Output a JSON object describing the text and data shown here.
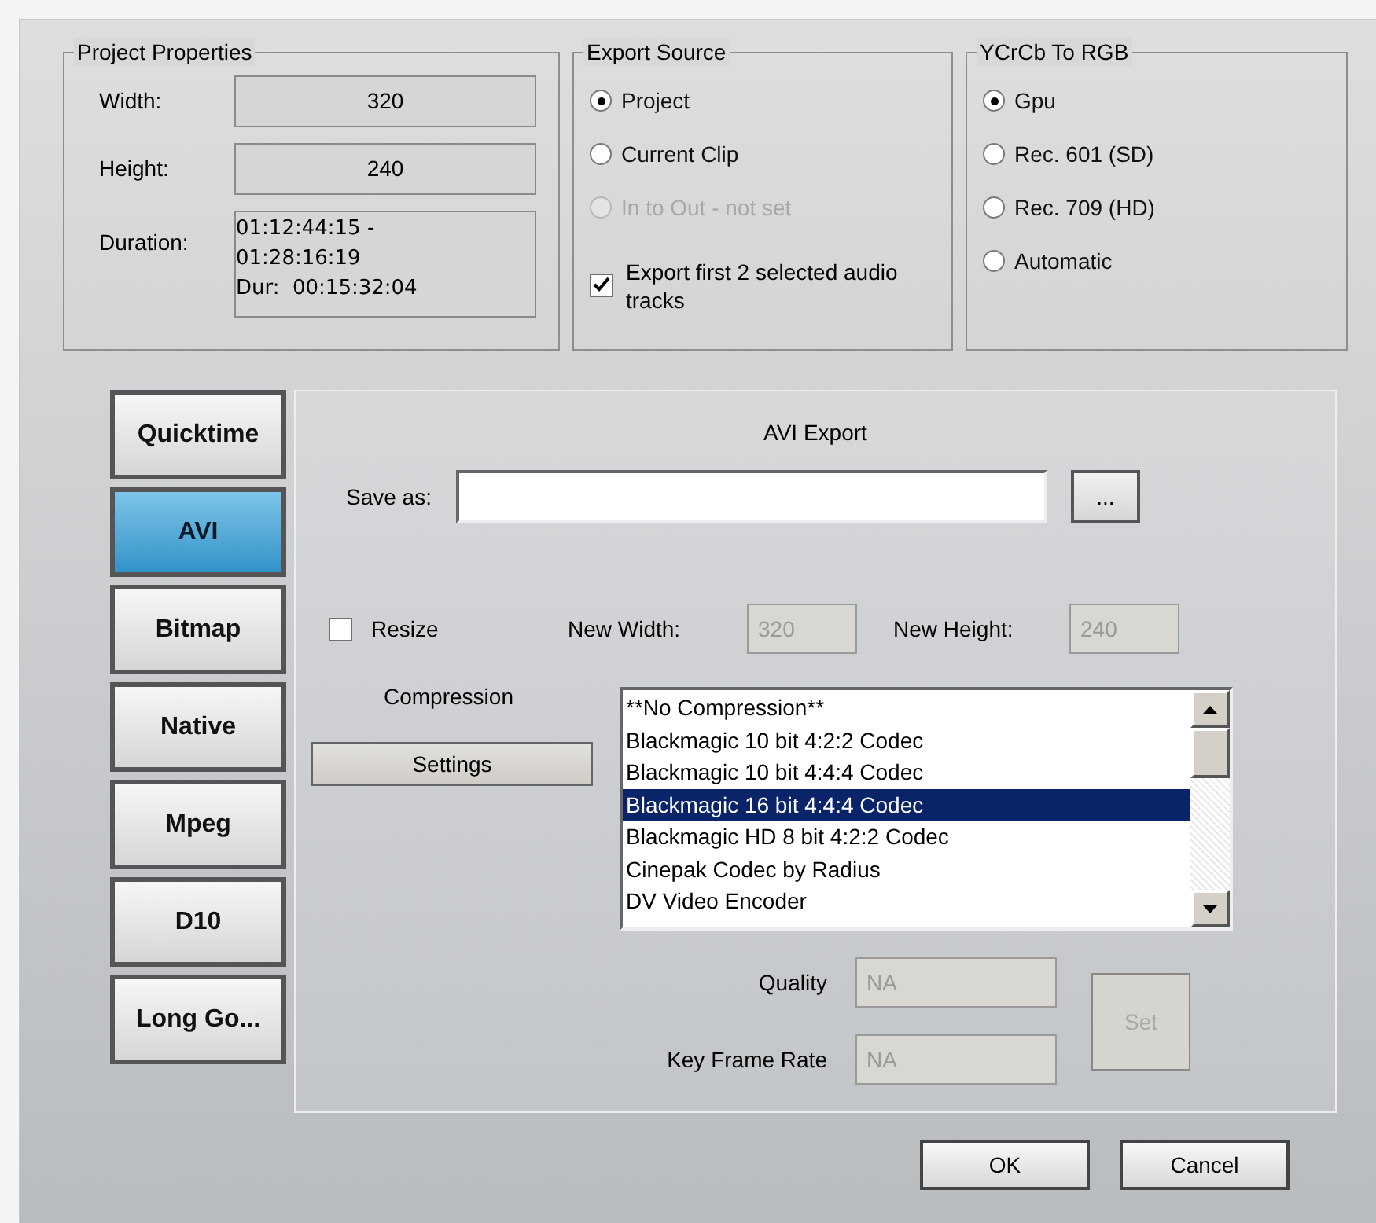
{
  "project_properties": {
    "title": "Project Properties",
    "fields": [
      {
        "label": "Width:",
        "value": "320"
      },
      {
        "label": "Height:",
        "value": "240"
      }
    ],
    "duration": {
      "label": "Duration:",
      "lines": [
        "01:12:44:15 -",
        "01:28:16:19",
        "Dur:  00:15:32:04"
      ]
    }
  },
  "export_source": {
    "title": "Export Source",
    "options": [
      {
        "label": "Project",
        "selected": true,
        "disabled": false
      },
      {
        "label": "Current Clip",
        "selected": false,
        "disabled": false
      },
      {
        "label": "In to Out - not set",
        "selected": false,
        "disabled": true
      }
    ],
    "audio_checkbox": {
      "label": "Export first 2 selected audio tracks",
      "checked": true
    }
  },
  "ycrcb_to_rgb": {
    "title": "YCrCb To RGB",
    "options": [
      {
        "label": "Gpu",
        "selected": true
      },
      {
        "label": "Rec. 601 (SD)",
        "selected": false
      },
      {
        "label": "Rec. 709 (HD)",
        "selected": false
      },
      {
        "label": "Automatic",
        "selected": false
      }
    ]
  },
  "format_tabs": [
    {
      "label": "Quicktime",
      "selected": false
    },
    {
      "label": "AVI",
      "selected": true
    },
    {
      "label": "Bitmap",
      "selected": false
    },
    {
      "label": "Native",
      "selected": false
    },
    {
      "label": "Mpeg",
      "selected": false
    },
    {
      "label": "D10",
      "selected": false
    },
    {
      "label": "Long Go...",
      "selected": false
    }
  ],
  "panel": {
    "title": "AVI Export",
    "save_as_label": "Save as:",
    "browse_button": "...",
    "resize": {
      "label": "Resize",
      "checked": false
    },
    "new_width": {
      "label": "New Width:",
      "value": "320",
      "disabled": true
    },
    "new_height": {
      "label": "New Height:",
      "value": "240",
      "disabled": true
    },
    "compression_label": "Compression",
    "settings_button": "Settings",
    "codecs": [
      {
        "label": "**No Compression**",
        "selected": false
      },
      {
        "label": "Blackmagic 10 bit 4:2:2 Codec",
        "selected": false
      },
      {
        "label": "Blackmagic 10 bit 4:4:4 Codec",
        "selected": false
      },
      {
        "label": "Blackmagic 16 bit 4:4:4 Codec",
        "selected": true
      },
      {
        "label": "Blackmagic HD 8 bit 4:2:2 Codec",
        "selected": false
      },
      {
        "label": "Cinepak Codec by Radius",
        "selected": false
      },
      {
        "label": "DV Video Encoder",
        "selected": false
      }
    ],
    "quality": {
      "label": "Quality",
      "value": "NA",
      "disabled": true
    },
    "key_frame_rate": {
      "label": "Key Frame Rate",
      "value": "NA",
      "disabled": true
    },
    "set_button": {
      "label": "Set",
      "disabled": true
    }
  },
  "buttons": [
    "OK",
    "Cancel"
  ]
}
